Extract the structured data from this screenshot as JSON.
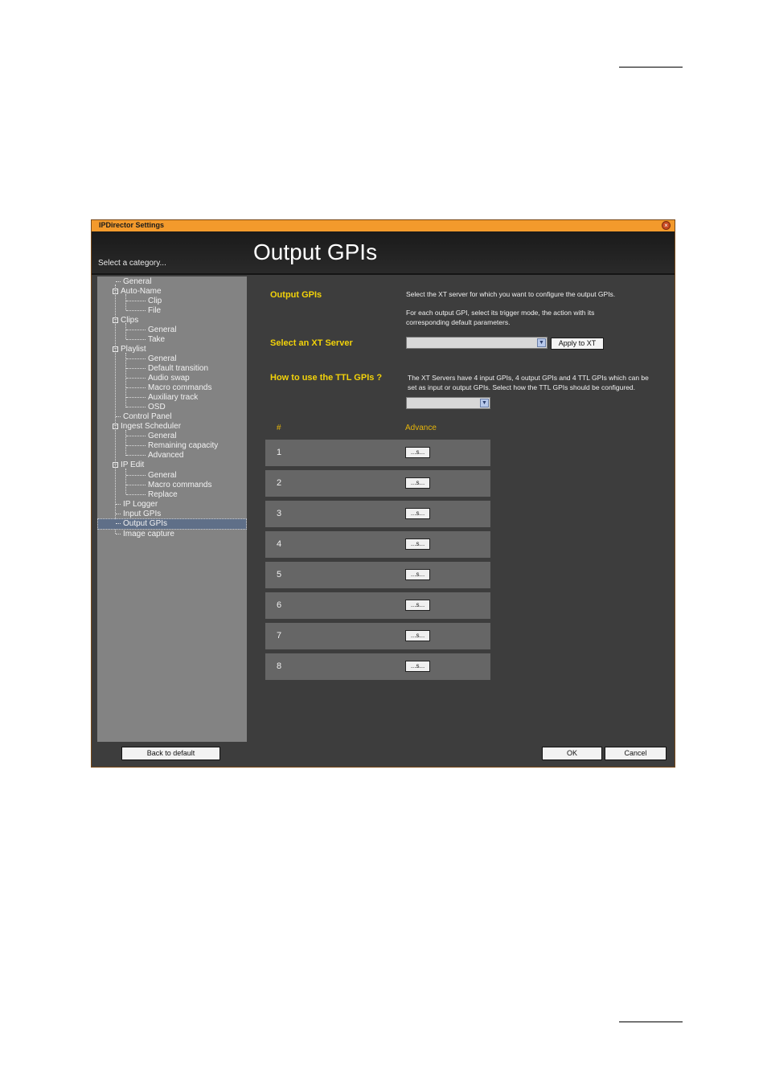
{
  "window": {
    "title": "IPDirector Settings",
    "close_glyph": "×"
  },
  "header": {
    "hint": "Select a category...",
    "page_title": "Output GPIs"
  },
  "sidebar": {
    "items": [
      {
        "label": "General"
      },
      {
        "label": "Auto-Name"
      },
      {
        "label": "Clip"
      },
      {
        "label": "File"
      },
      {
        "label": "Clips"
      },
      {
        "label": "General"
      },
      {
        "label": "Take"
      },
      {
        "label": "Playlist"
      },
      {
        "label": "General"
      },
      {
        "label": "Default transition"
      },
      {
        "label": "Audio swap"
      },
      {
        "label": "Macro commands"
      },
      {
        "label": "Auxiliary track"
      },
      {
        "label": "OSD"
      },
      {
        "label": "Control Panel"
      },
      {
        "label": "Ingest Scheduler"
      },
      {
        "label": "General"
      },
      {
        "label": "Remaining capacity"
      },
      {
        "label": "Advanced"
      },
      {
        "label": "IP Edit"
      },
      {
        "label": "General"
      },
      {
        "label": "Macro commands"
      },
      {
        "label": "Replace"
      },
      {
        "label": "IP Logger"
      },
      {
        "label": "Input GPIs"
      },
      {
        "label": "Output GPIs"
      },
      {
        "label": "Image capture"
      }
    ],
    "selected": "Output GPIs"
  },
  "content": {
    "section_label": "Output GPIs",
    "intro_line1": "Select the XT server for which you want to configure the output GPIs.",
    "intro_line2a": "For each output GPI, select its trigger mode, the action with its",
    "intro_line2b": "corresponding default parameters.",
    "server_label": "Select an XT Server",
    "server_value": "",
    "apply_button": "Apply to XT",
    "ttl_label": "How to use the TTL GPIs ?",
    "ttl_text_a": "The XT Servers have 4 input GPIs, 4 output GPIs and 4 TTL GPIs which can be",
    "ttl_text_b": "set as input or output GPIs. Select how the TTL GPIs should be configured.",
    "ttl_value": "",
    "col_num": "#",
    "col_advance": "Advance",
    "rows": [
      {
        "num": "1",
        "btn": "...s..."
      },
      {
        "num": "2",
        "btn": "...s..."
      },
      {
        "num": "3",
        "btn": "...s..."
      },
      {
        "num": "4",
        "btn": "...s..."
      },
      {
        "num": "5",
        "btn": "...s..."
      },
      {
        "num": "6",
        "btn": "...s..."
      },
      {
        "num": "7",
        "btn": "...s..."
      },
      {
        "num": "8",
        "btn": "...s..."
      }
    ]
  },
  "footer": {
    "back_default": "Back to default",
    "ok": "OK",
    "cancel": "Cancel"
  },
  "colors": {
    "title_bar": "#f39a2c",
    "accent_label": "#f2d20a",
    "panel_bg": "#3d3d3d",
    "tree_bg": "#838383"
  }
}
